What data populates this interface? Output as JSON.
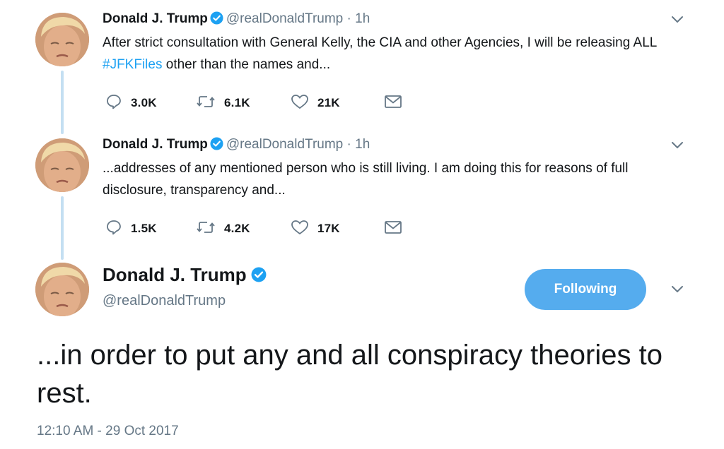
{
  "tweets": [
    {
      "name": "Donald J. Trump",
      "handle": "@realDonaldTrump",
      "time": "· 1h",
      "text_before": "After strict consultation with General Kelly, the CIA and other Agencies, I will be releasing ALL ",
      "hashtag": "#JFKFiles",
      "text_after": " other than the names and...",
      "replies": "3.0K",
      "retweets": "6.1K",
      "likes": "21K"
    },
    {
      "name": "Donald J. Trump",
      "handle": "@realDonaldTrump",
      "time": "· 1h",
      "text": "...addresses of any mentioned person who is still living. I am doing this for reasons of full disclosure, transparency and...",
      "replies": "1.5K",
      "retweets": "4.2K",
      "likes": "17K"
    }
  ],
  "main": {
    "name": "Donald J. Trump",
    "handle": "@realDonaldTrump",
    "follow_label": "Following",
    "text": "...in order to put any and all conspiracy theories to rest.",
    "timestamp": "12:10 AM - 29 Oct 2017"
  },
  "icons": {
    "verified": "verified-badge-icon",
    "caret": "chevron-down-icon",
    "reply": "reply-icon",
    "retweet": "retweet-icon",
    "like": "heart-icon",
    "dm": "envelope-icon"
  },
  "colors": {
    "link": "#1da1f2",
    "follow_button": "#55acee",
    "muted": "#657786",
    "thread_line": "#c4dff2"
  }
}
